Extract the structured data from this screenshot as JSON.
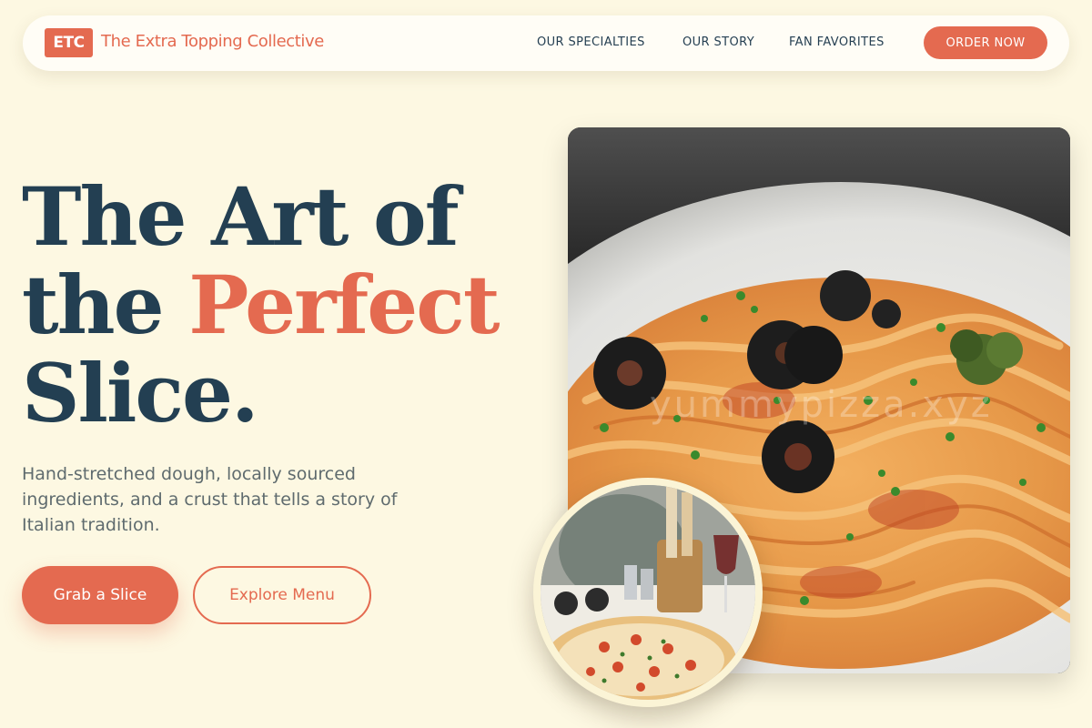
{
  "nav": {
    "logo_abbr": "ETC",
    "brand": "The Extra Topping Collective",
    "links": [
      "OUR SPECIALTIES",
      "OUR STORY",
      "FAN FAVORITES"
    ],
    "cta": "ORDER NOW"
  },
  "hero": {
    "headline_line1": "The Art of",
    "headline_line2_start": "the ",
    "headline_line2_accent": "Perfect",
    "headline_line3": "Slice.",
    "subtext": "Hand-stretched dough, locally sourced ingredients, and a crust that tells a story of Italian tradition.",
    "primary_button": "Grab a Slice",
    "secondary_button": "Explore Menu"
  },
  "images": {
    "main_watermark": "yummypizza.xyz"
  },
  "colors": {
    "background": "#fdf8e2",
    "accent": "#e46a50",
    "navy": "#233f52"
  }
}
